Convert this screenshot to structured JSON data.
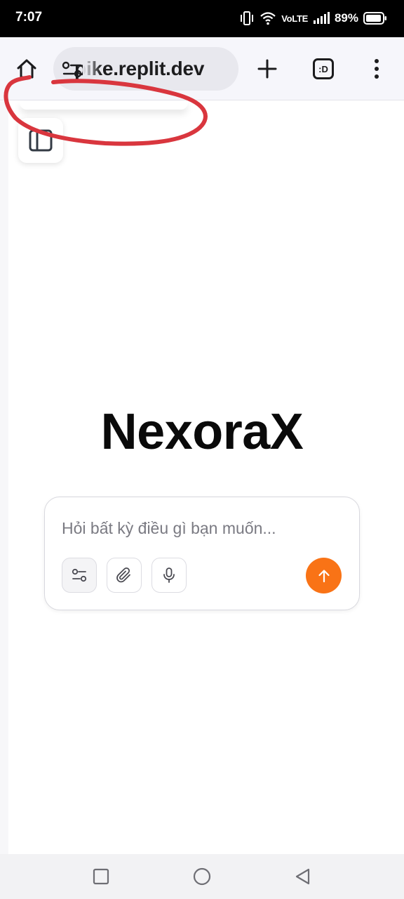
{
  "status_bar": {
    "time": "7:07",
    "network_label": "VoLTE",
    "battery_percent": "89%"
  },
  "browser": {
    "url_display": "pike.replit.dev",
    "tabs_label": ":D",
    "icons": {
      "home": "home-icon",
      "site_settings": "tune-icon",
      "new_tab": "plus-icon",
      "tabs": "tab-switcher-icon",
      "menu": "more-vert-icon"
    }
  },
  "page": {
    "sidebar_toggle_icon": "sidebar-panel-icon",
    "app_title": "NexoraX",
    "chat": {
      "placeholder": "Hỏi bất kỳ điều gì bạn muốn...",
      "value": "",
      "tools": [
        {
          "name": "options",
          "icon": "sliders-icon"
        },
        {
          "name": "attach",
          "icon": "paperclip-icon"
        },
        {
          "name": "voice",
          "icon": "microphone-icon"
        }
      ],
      "send_icon": "arrow-up-icon",
      "send_color": "#f97316"
    }
  },
  "annotation": {
    "type": "freehand-circle",
    "color": "#d9363e"
  },
  "nav_bar": {
    "buttons": [
      "recents-icon",
      "home-circle-icon",
      "back-triangle-icon"
    ]
  }
}
